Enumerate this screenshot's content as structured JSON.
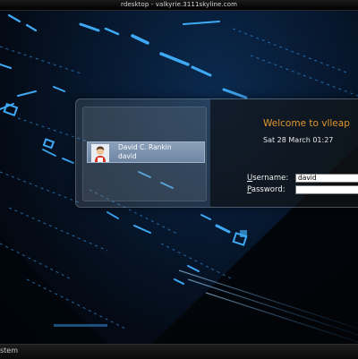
{
  "window": {
    "title": "rdesktop - valkyrie.3111skyline.com"
  },
  "login": {
    "welcome": "Welcome to vlleap",
    "datetime": "Sat 28 March 01:27",
    "user": {
      "full_name": "David C. Rankin",
      "username": "david"
    },
    "username_label": {
      "underline": "U",
      "rest": "sername:"
    },
    "password_label": {
      "underline": "P",
      "rest": "assword:"
    },
    "username_value": "david",
    "password_value": ""
  },
  "taskbar": {
    "label": "stem"
  },
  "colors": {
    "accent_orange": "#e0962e",
    "glow_blue": "#3fa9f5",
    "selected_row": "#7b92ae"
  },
  "icons": {
    "avatar": "user-avatar-icon"
  }
}
